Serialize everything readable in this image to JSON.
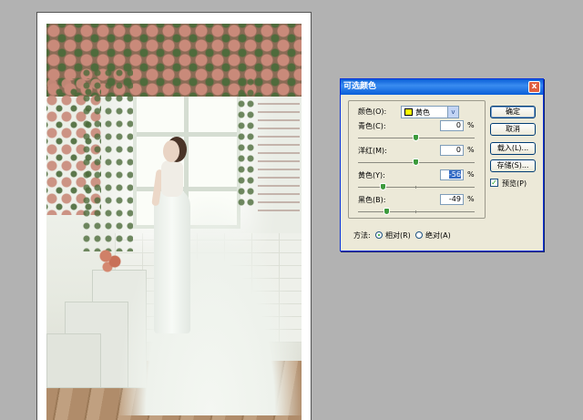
{
  "dialog": {
    "title": "可选颜色",
    "close_glyph": "x",
    "colors_label": "颜色(O):",
    "colors_value": "黄色",
    "colors_swatch_color": "#ffff00",
    "dropdown_glyph": "v",
    "sliders": [
      {
        "label": "青色(C):",
        "value": "0",
        "unit": "%",
        "level": 0
      },
      {
        "label": "洋红(M):",
        "value": "0",
        "unit": "%",
        "level": 0
      },
      {
        "label": "黄色(Y):",
        "value": "-56",
        "unit": "%",
        "level": -56
      },
      {
        "label": "黑色(B):",
        "value": "-49",
        "unit": "%",
        "level": -49
      }
    ],
    "buttons": {
      "ok": "确定",
      "cancel": "取消",
      "load": "载入(L)...",
      "save": "存储(S)..."
    },
    "preview_label": "预览(P)",
    "preview_checked": true,
    "check_glyph": "✓",
    "method_label": "方法:",
    "method_relative": "相对(R)",
    "method_absolute": "绝对(A)",
    "method_selected": "relative"
  },
  "photo": {
    "accent_colors": {
      "roses": "#c98a7a",
      "leaves": "#4f6b3c",
      "floor": "#b08c6a"
    }
  }
}
